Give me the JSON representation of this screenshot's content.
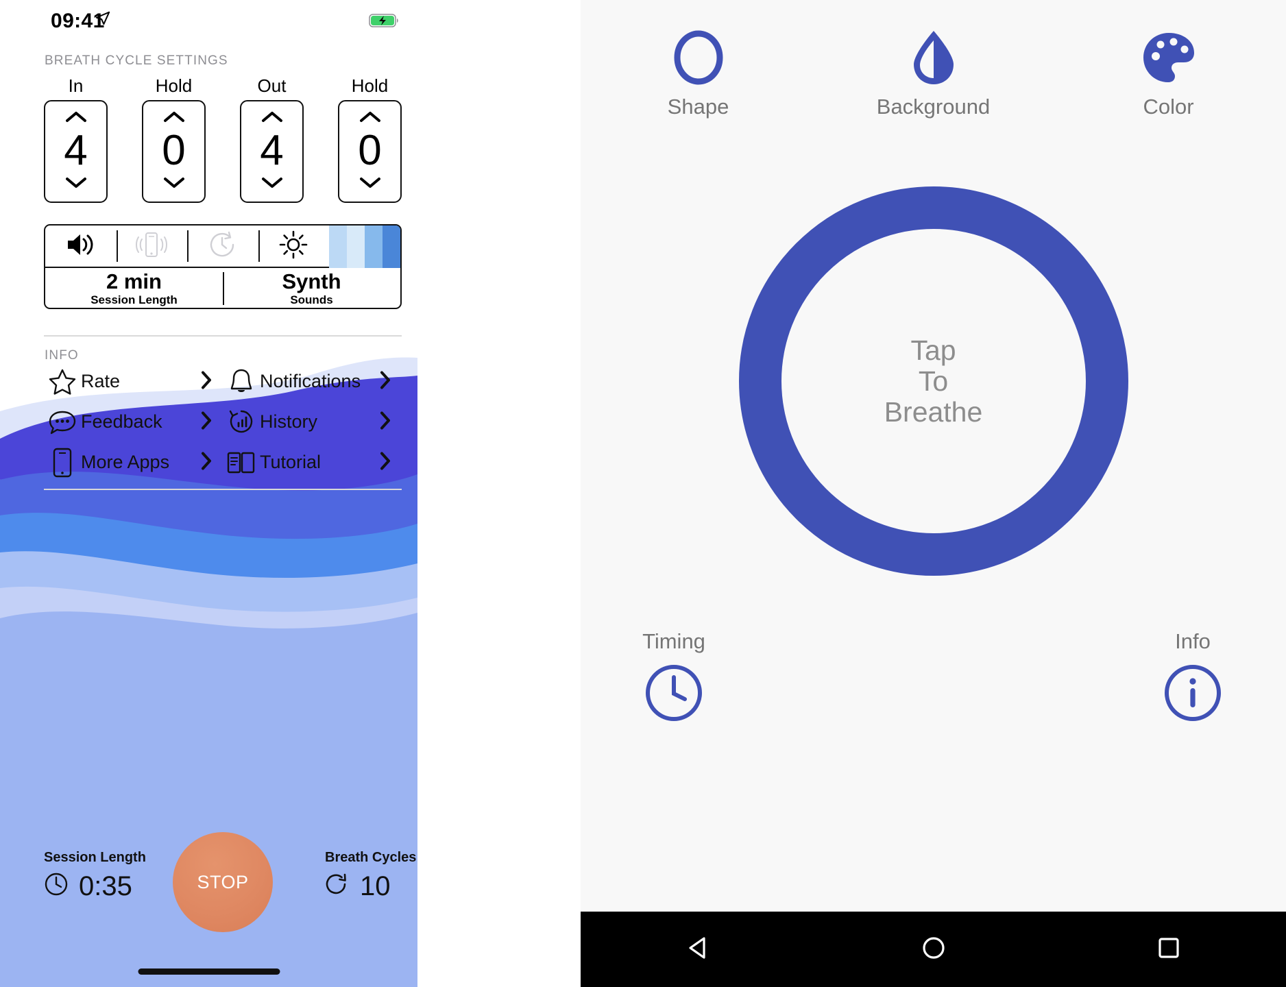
{
  "ios": {
    "status_bar": {
      "time": "09:41",
      "location_icon": "location-arrow-icon",
      "battery_icon": "battery-charging-icon"
    },
    "breath_cycle": {
      "section_label": "BREATH CYCLE SETTINGS",
      "steppers": [
        {
          "caption": "In",
          "value": "4",
          "up_icon": "chevron-up-icon",
          "down_icon": "chevron-down-icon"
        },
        {
          "caption": "Hold",
          "value": "0",
          "up_icon": "chevron-up-icon",
          "down_icon": "chevron-down-icon"
        },
        {
          "caption": "Out",
          "value": "4",
          "up_icon": "chevron-up-icon",
          "down_icon": "chevron-down-icon"
        },
        {
          "caption": "Hold",
          "value": "0",
          "up_icon": "chevron-up-icon",
          "down_icon": "chevron-down-icon"
        }
      ]
    },
    "control_bar": {
      "toggles": [
        {
          "icon": "speaker-on-icon",
          "state": "enabled"
        },
        {
          "icon": "vibration-icon",
          "state": "disabled"
        },
        {
          "icon": "clock-rewind-icon",
          "state": "disabled"
        },
        {
          "icon": "brightness-sun-icon",
          "state": "enabled"
        }
      ],
      "color_swatches": [
        "#bcd9f5",
        "#d8eaf9",
        "#86b9ec",
        "#4a86d8"
      ],
      "values": [
        {
          "value": "2 min",
          "label": "Session Length"
        },
        {
          "value": "Synth",
          "label": "Sounds"
        }
      ]
    },
    "info": {
      "section_label": "INFO",
      "rows": [
        [
          {
            "label": "Rate",
            "icon": "star-icon",
            "chevron": "chevron-right-icon"
          },
          {
            "label": "Notifications",
            "icon": "bell-icon",
            "chevron": "chevron-right-icon"
          }
        ],
        [
          {
            "label": "Feedback",
            "icon": "speech-bubble-icon",
            "chevron": "chevron-right-icon"
          },
          {
            "label": "History",
            "icon": "history-chart-icon",
            "chevron": "chevron-right-icon"
          }
        ],
        [
          {
            "label": "More Apps",
            "icon": "phone-icon",
            "chevron": "chevron-right-icon"
          },
          {
            "label": "Tutorial",
            "icon": "open-book-icon",
            "chevron": "chevron-right-icon"
          }
        ]
      ]
    },
    "session": {
      "left_stat": {
        "label": "Session Length",
        "value": "0:35",
        "icon": "clock-icon"
      },
      "right_stat": {
        "label": "Breath Cycles",
        "value": "10",
        "icon": "refresh-cycle-icon"
      },
      "stop_button": {
        "label": "STOP",
        "color": "#df8862"
      }
    },
    "wave_colors": [
      "#dee5fa",
      "#4b45d8",
      "#4f67e0",
      "#4e8bec",
      "#a7c0f5",
      "#c3d0f7",
      "#9cb4f2"
    ]
  },
  "android": {
    "accent_color": "#4051b5",
    "background_color": "#f8f8f8",
    "top_tools": [
      {
        "label": "Shape",
        "icon": "circle-outline-icon"
      },
      {
        "label": "Background",
        "icon": "droplet-half-icon"
      },
      {
        "label": "Color",
        "icon": "palette-icon"
      }
    ],
    "breath_ring": {
      "text_lines": [
        "Tap",
        "To",
        "Breathe"
      ]
    },
    "bottom_tools": [
      {
        "label": "Timing",
        "icon": "clock-icon"
      },
      {
        "label": "Info",
        "icon": "info-circle-icon"
      }
    ],
    "nav_bar": [
      {
        "name": "back",
        "icon": "triangle-back-icon"
      },
      {
        "name": "home",
        "icon": "circle-home-icon"
      },
      {
        "name": "recents",
        "icon": "square-recents-icon"
      }
    ]
  }
}
